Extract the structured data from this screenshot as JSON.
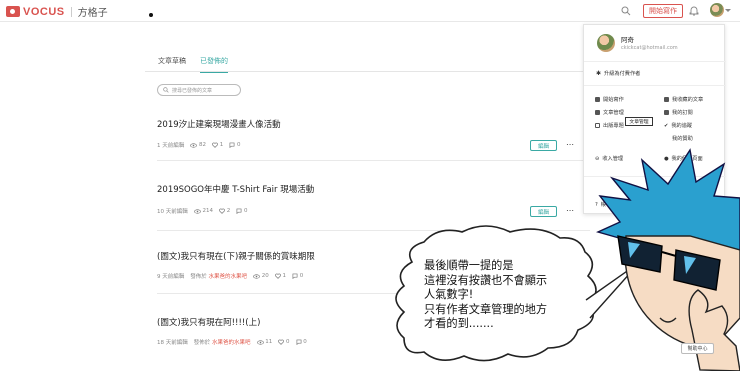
{
  "header": {
    "brand": "VOCUS",
    "section": "方格子",
    "start_button": "開始寫作"
  },
  "tabs": [
    {
      "label": "文章草稿",
      "active": false
    },
    {
      "label": "已發佈的",
      "active": true
    }
  ],
  "search": {
    "placeholder": "搜尋已發佈的文章"
  },
  "articles": [
    {
      "title": "2019汐止建案現場漫畫人像活動",
      "time": "1 天前編輯",
      "views": "82",
      "likes": "1",
      "comments": "0",
      "edit_label": "編輯",
      "more": "⋯"
    },
    {
      "title": "2019SOGO年中慶 T-Shirt Fair 現場活動",
      "time": "10 天前編輯",
      "views": "214",
      "likes": "2",
      "comments": "0",
      "edit_label": "編輯",
      "more": "⋯"
    },
    {
      "title": "(圖文)我只有現在(下)親子關係的賞味期限",
      "time": "9 天前編輯",
      "pub_prefix": "發佈於",
      "pub_target": "水果爸的水果吧",
      "views": "20",
      "likes": "1",
      "comments": "0",
      "edit_label": "編輯",
      "more": "⋯"
    },
    {
      "title": "(圖文)我只有現在阿!!!!(上)",
      "time": "18 天前編輯",
      "pub_prefix": "發佈於",
      "pub_target": "水果爸的水果吧",
      "views": "11",
      "likes": "0",
      "comments": "0",
      "edit_label": "編輯",
      "more": "⋯"
    }
  ],
  "dropdown": {
    "name": "阿奇",
    "email": "ckickcat@hotmail.com",
    "upgrade": "升級為付費作者",
    "left_items": [
      "開始寫作",
      "文章管理",
      "出版專題",
      "收入管理"
    ],
    "right_items": [
      "我收藏的文章",
      "我的訂閱",
      "我的追蹤",
      "我的贊助",
      "我的個人頁面"
    ],
    "tooltip": "文章管理",
    "bottom": "帳"
  },
  "help_button": "幫助中心",
  "speech_bubble": [
    "最後順帶一提的是",
    "這裡沒有按讚也不會顯示",
    "人氣數字!",
    "只有作者文章管理的地方",
    "才看的到......."
  ],
  "colors": {
    "brand": "#d9534f",
    "accent": "#3aa9a4"
  }
}
